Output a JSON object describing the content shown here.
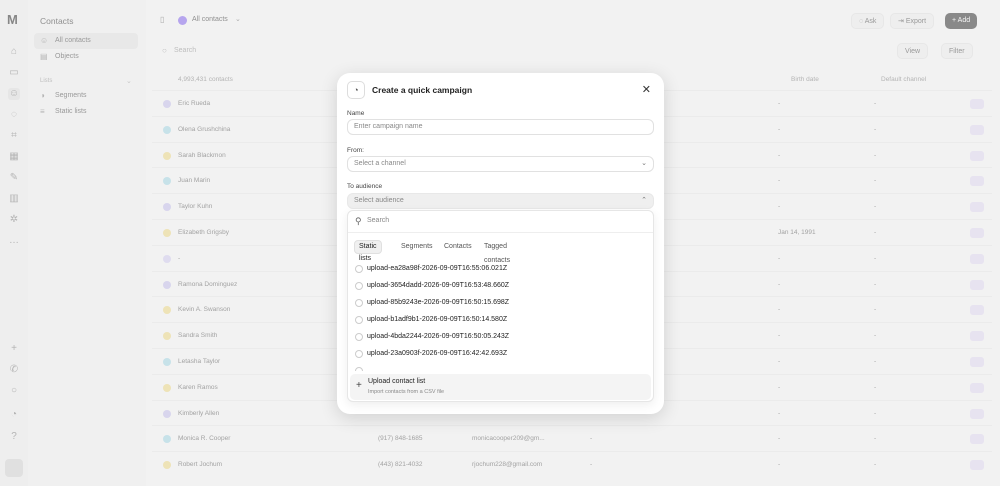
{
  "sidebar": {
    "title": "Contacts",
    "items": [
      {
        "label": "All contacts"
      },
      {
        "label": "Objects"
      }
    ],
    "lists_heading": "Lists",
    "list_items": [
      {
        "label": "Segments"
      },
      {
        "label": "Static lists"
      }
    ]
  },
  "header": {
    "view_name": "All contacts",
    "ask_label": "Ask",
    "export_label": "Export",
    "add_label": "Add"
  },
  "toolbar": {
    "search_placeholder": "Search",
    "view_label": "View",
    "filter_label": "Filter"
  },
  "table": {
    "count_label": "4,993,431 contacts",
    "columns": [
      "Birth date",
      "Default channel"
    ],
    "rows": [
      {
        "name": "Eric Rueda",
        "phone": "",
        "email": "",
        "extra": "",
        "birth": "-",
        "channel": "-",
        "color": "#c9c3ef"
      },
      {
        "name": "Olena Grushchina",
        "phone": "",
        "email": "",
        "extra": "",
        "birth": "-",
        "channel": "-",
        "color": "#a9dbe8"
      },
      {
        "name": "Sarah Blackmon",
        "phone": "",
        "email": "",
        "extra": "",
        "birth": "-",
        "channel": "-",
        "color": "#f0dc8c"
      },
      {
        "name": "Juan Marin",
        "phone": "",
        "email": "",
        "extra": "",
        "birth": "-",
        "channel": "-",
        "color": "#a9dbe8"
      },
      {
        "name": "Taylor Kuhn",
        "phone": "",
        "email": "",
        "extra": "",
        "birth": "-",
        "channel": "-",
        "color": "#c9c3ef"
      },
      {
        "name": "Elizabeth Grigsby",
        "phone": "",
        "email": "",
        "extra": "",
        "birth": "Jan 14, 1991",
        "channel": "-",
        "color": "#f0dc8c"
      },
      {
        "name": "-",
        "phone": "",
        "email": "",
        "extra": "",
        "birth": "-",
        "channel": "-",
        "color": "#d6d0f2"
      },
      {
        "name": "Ramona Dominguez",
        "phone": "",
        "email": "",
        "extra": "",
        "birth": "-",
        "channel": "-",
        "color": "#c9c3ef"
      },
      {
        "name": "Kevin A. Swanson",
        "phone": "",
        "email": "",
        "extra": "",
        "birth": "-",
        "channel": "-",
        "color": "#f0dc8c"
      },
      {
        "name": "Sandra Smith",
        "phone": "",
        "email": "",
        "extra": "",
        "birth": "-",
        "channel": "-",
        "color": "#f0dc8c"
      },
      {
        "name": "Letasha Taylor",
        "phone": "",
        "email": "",
        "extra": "",
        "birth": "-",
        "channel": "-",
        "color": "#a9dbe8"
      },
      {
        "name": "Karen Ramos",
        "phone": "",
        "email": "",
        "extra": "",
        "birth": "-",
        "channel": "-",
        "color": "#f0dc8c"
      },
      {
        "name": "Kimberly Allen",
        "phone": "",
        "email": "",
        "extra": "",
        "birth": "-",
        "channel": "-",
        "color": "#c9c3ef"
      },
      {
        "name": "Monica R. Cooper",
        "phone": "(917) 848-1685",
        "email": "monicacooper209@gm...",
        "extra": "-",
        "birth": "-",
        "channel": "-",
        "color": "#a9dbe8"
      },
      {
        "name": "Robert Jochum",
        "phone": "(443) 821-4032",
        "email": "rjochum228@gmail.com",
        "extra": "-",
        "birth": "-",
        "channel": "-",
        "color": "#f0dc8c"
      }
    ]
  },
  "modal": {
    "title": "Create a quick campaign",
    "name_label": "Name",
    "name_placeholder": "Enter campaign name",
    "from_label": "From:",
    "from_placeholder": "Select a channel",
    "audience_label": "To audience",
    "audience_placeholder": "Select audience",
    "dropdown": {
      "search_placeholder": "Search",
      "tabs": [
        "Static lists",
        "Segments",
        "Contacts",
        "Tagged contacts"
      ],
      "options": [
        "upload-ea28a98f-2026-09-09T16:55:06.021Z",
        "upload-3654dadd-2026-09-09T16:53:48.660Z",
        "upload-85b9243e-2026-09-09T16:50:15.698Z",
        "upload-b1adf9b1-2026-09-09T16:50:14.580Z",
        "upload-4bda2244-2026-09-09T16:50:05.243Z",
        "upload-23a0903f-2026-09-09T16:42:42.693Z"
      ],
      "upload_title": "Upload contact list",
      "upload_subtitle": "Import contacts from a CSV file"
    }
  },
  "colors": {
    "accent": "#8b6cf0",
    "add_button": "#3a3a3a"
  }
}
